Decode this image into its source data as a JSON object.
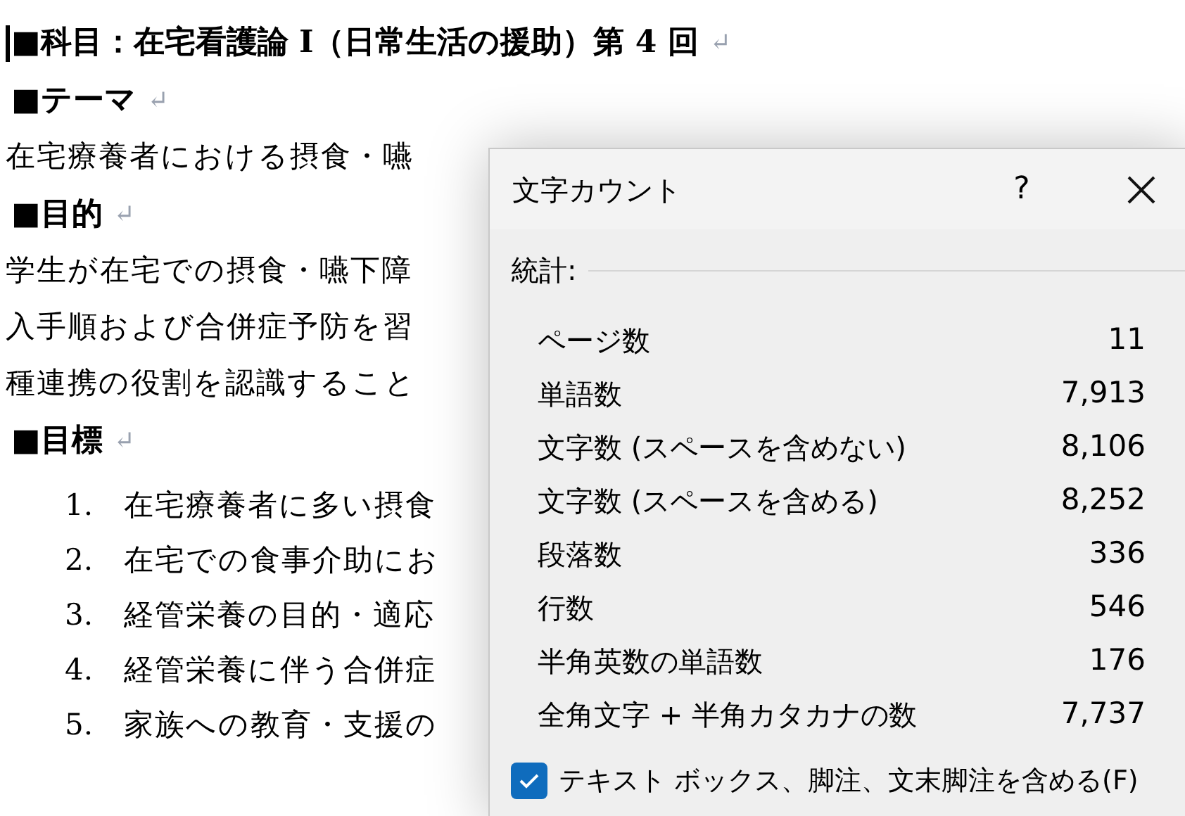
{
  "document": {
    "lines": [
      {
        "kind": "heading",
        "text": "■科目：在宅看護論 I（日常生活の援助）第 4 回",
        "mark": "↵",
        "cursor": true
      },
      {
        "kind": "heading",
        "text": "■テーマ",
        "mark": "↵",
        "cursor": false
      },
      {
        "kind": "body",
        "text": "在宅療養者における摂食・嚥"
      },
      {
        "kind": "heading",
        "text": "■目的",
        "mark": "↵",
        "cursor": false
      },
      {
        "kind": "body",
        "text": "学生が在宅での摂食・嚥下障"
      },
      {
        "kind": "body",
        "text": "入手順および合併症予防を習"
      },
      {
        "kind": "body",
        "text": "種連携の役割を認識すること"
      },
      {
        "kind": "heading",
        "text": "■目標",
        "mark": "↵",
        "cursor": false
      },
      {
        "kind": "list",
        "number": "1.",
        "text": "在宅療養者に多い摂食"
      },
      {
        "kind": "list",
        "number": "2.",
        "text": "在宅での食事介助にお"
      },
      {
        "kind": "list",
        "number": "3.",
        "text": "経管栄養の目的・適応"
      },
      {
        "kind": "list",
        "number": "4.",
        "text": "経管栄養に伴う合併症"
      },
      {
        "kind": "list",
        "number": "5.",
        "text": "家族への教育・支援の"
      }
    ]
  },
  "dialog": {
    "title": "文字カウント",
    "help": "?",
    "section": "統計:",
    "stats": [
      {
        "label": "ページ数",
        "value": "11"
      },
      {
        "label": "単語数",
        "value": "7,913"
      },
      {
        "label": "文字数 (スペースを含めない)",
        "value": "8,106"
      },
      {
        "label": "文字数 (スペースを含める)",
        "value": "8,252"
      },
      {
        "label": "段落数",
        "value": "336"
      },
      {
        "label": "行数",
        "value": "546"
      },
      {
        "label": "半角英数の単語数",
        "value": "176"
      },
      {
        "label": "全角文字 + 半角カタカナの数",
        "value": "7,737"
      }
    ],
    "checkbox": {
      "label": "テキスト ボックス、脚注、文末脚注を含める(F)",
      "checked": true
    }
  }
}
